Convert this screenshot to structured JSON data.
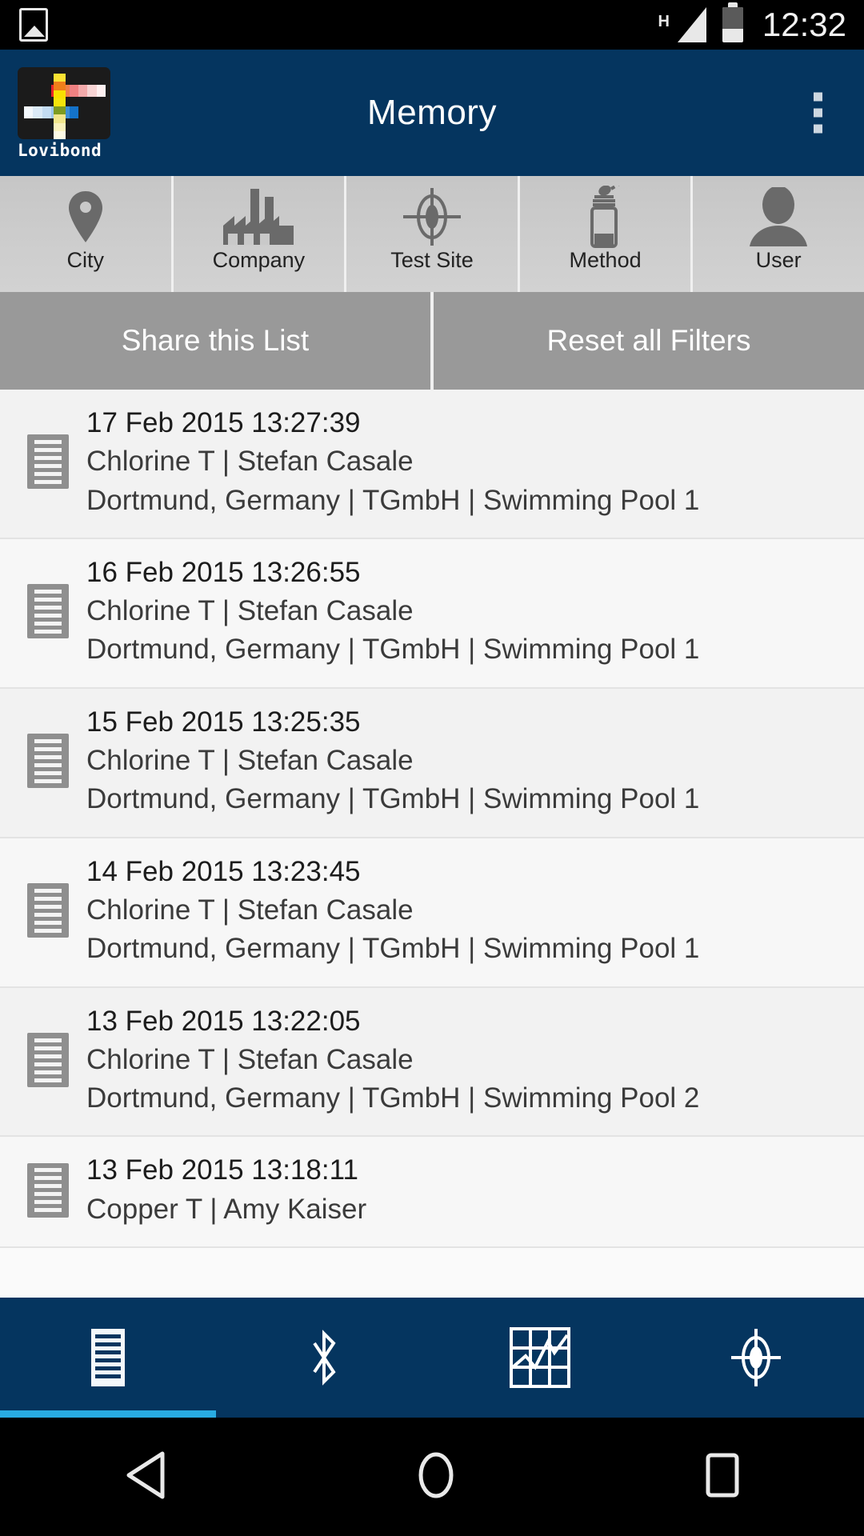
{
  "statusbar": {
    "photo_icon": "photo-icon",
    "network_type": "H",
    "signal_icon": "signal-icon",
    "battery_icon": "battery-icon",
    "clock": "12:32"
  },
  "appbar": {
    "logo_word": "Lovibond",
    "title": "Memory",
    "overflow_icon": "overflow-menu-icon",
    "bg_color": "#05355f"
  },
  "filters": [
    {
      "label": "City",
      "icon": "map-pin-icon"
    },
    {
      "label": "Company",
      "icon": "factory-icon"
    },
    {
      "label": "Test Site",
      "icon": "crosshair-icon"
    },
    {
      "label": "Method",
      "icon": "reagent-bottle-icon"
    },
    {
      "label": "User",
      "icon": "user-icon"
    }
  ],
  "actions": {
    "share": "Share this List",
    "reset": "Reset all Filters"
  },
  "records": [
    {
      "date": "17 Feb 2015 13:27:39",
      "method_user": "Chlorine T | Stefan Casale",
      "location": "Dortmund, Germany | TGmbH | Swimming Pool 1"
    },
    {
      "date": "16 Feb 2015 13:26:55",
      "method_user": "Chlorine T | Stefan Casale",
      "location": "Dortmund, Germany | TGmbH | Swimming Pool 1"
    },
    {
      "date": "15 Feb 2015 13:25:35",
      "method_user": "Chlorine T | Stefan Casale",
      "location": "Dortmund, Germany | TGmbH | Swimming Pool 1"
    },
    {
      "date": "14 Feb 2015 13:23:45",
      "method_user": "Chlorine T | Stefan Casale",
      "location": "Dortmund, Germany | TGmbH | Swimming Pool 1"
    },
    {
      "date": "13 Feb 2015 13:22:05",
      "method_user": "Chlorine T | Stefan Casale",
      "location": "Dortmund, Germany | TGmbH | Swimming Pool 2"
    },
    {
      "date": "13 Feb 2015 13:18:11",
      "method_user": "Copper T | Amy Kaiser",
      "location": ""
    }
  ],
  "bottomnav": {
    "items": [
      {
        "icon": "list-records-icon",
        "selected": true
      },
      {
        "icon": "bluetooth-icon",
        "selected": false
      },
      {
        "icon": "graph-chart-icon",
        "selected": false
      },
      {
        "icon": "crosshair-icon",
        "selected": false
      }
    ],
    "indicator_color": "#29abe2"
  },
  "androidnav": {
    "back": "back-triangle-icon",
    "home": "home-circle-icon",
    "recents": "recents-square-icon"
  }
}
